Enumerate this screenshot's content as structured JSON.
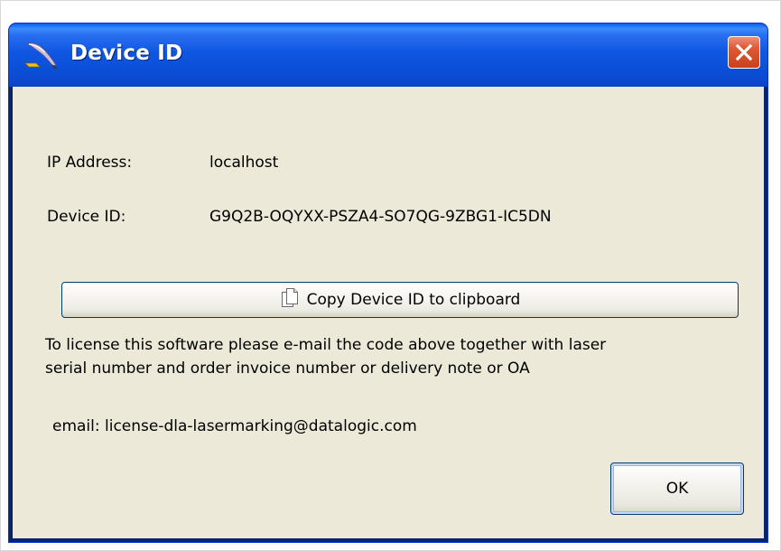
{
  "window": {
    "title": "Device ID"
  },
  "fields": {
    "ip_label": "IP Address:",
    "ip_value": "localhost",
    "device_label": "Device ID:",
    "device_value": "G9Q2B-OQYXX-PSZA4-SO7QG-9ZBG1-IC5DN"
  },
  "buttons": {
    "copy_label": "Copy Device ID to clipboard",
    "ok_label": "OK"
  },
  "message": {
    "line1": "To license this software please e-mail the code above together with laser",
    "line2": "serial number and order invoice number or delivery note or OA",
    "email": "email: license-dla-lasermarking@datalogic.com"
  },
  "icons": {
    "app": "quill-pen-icon",
    "close": "close-icon",
    "copy": "clipboard-copy-icon"
  },
  "colors": {
    "titlebar": "#0b50d8",
    "client_bg": "#ece9d8",
    "close_button": "#e05a36",
    "button_border": "#003c74"
  }
}
